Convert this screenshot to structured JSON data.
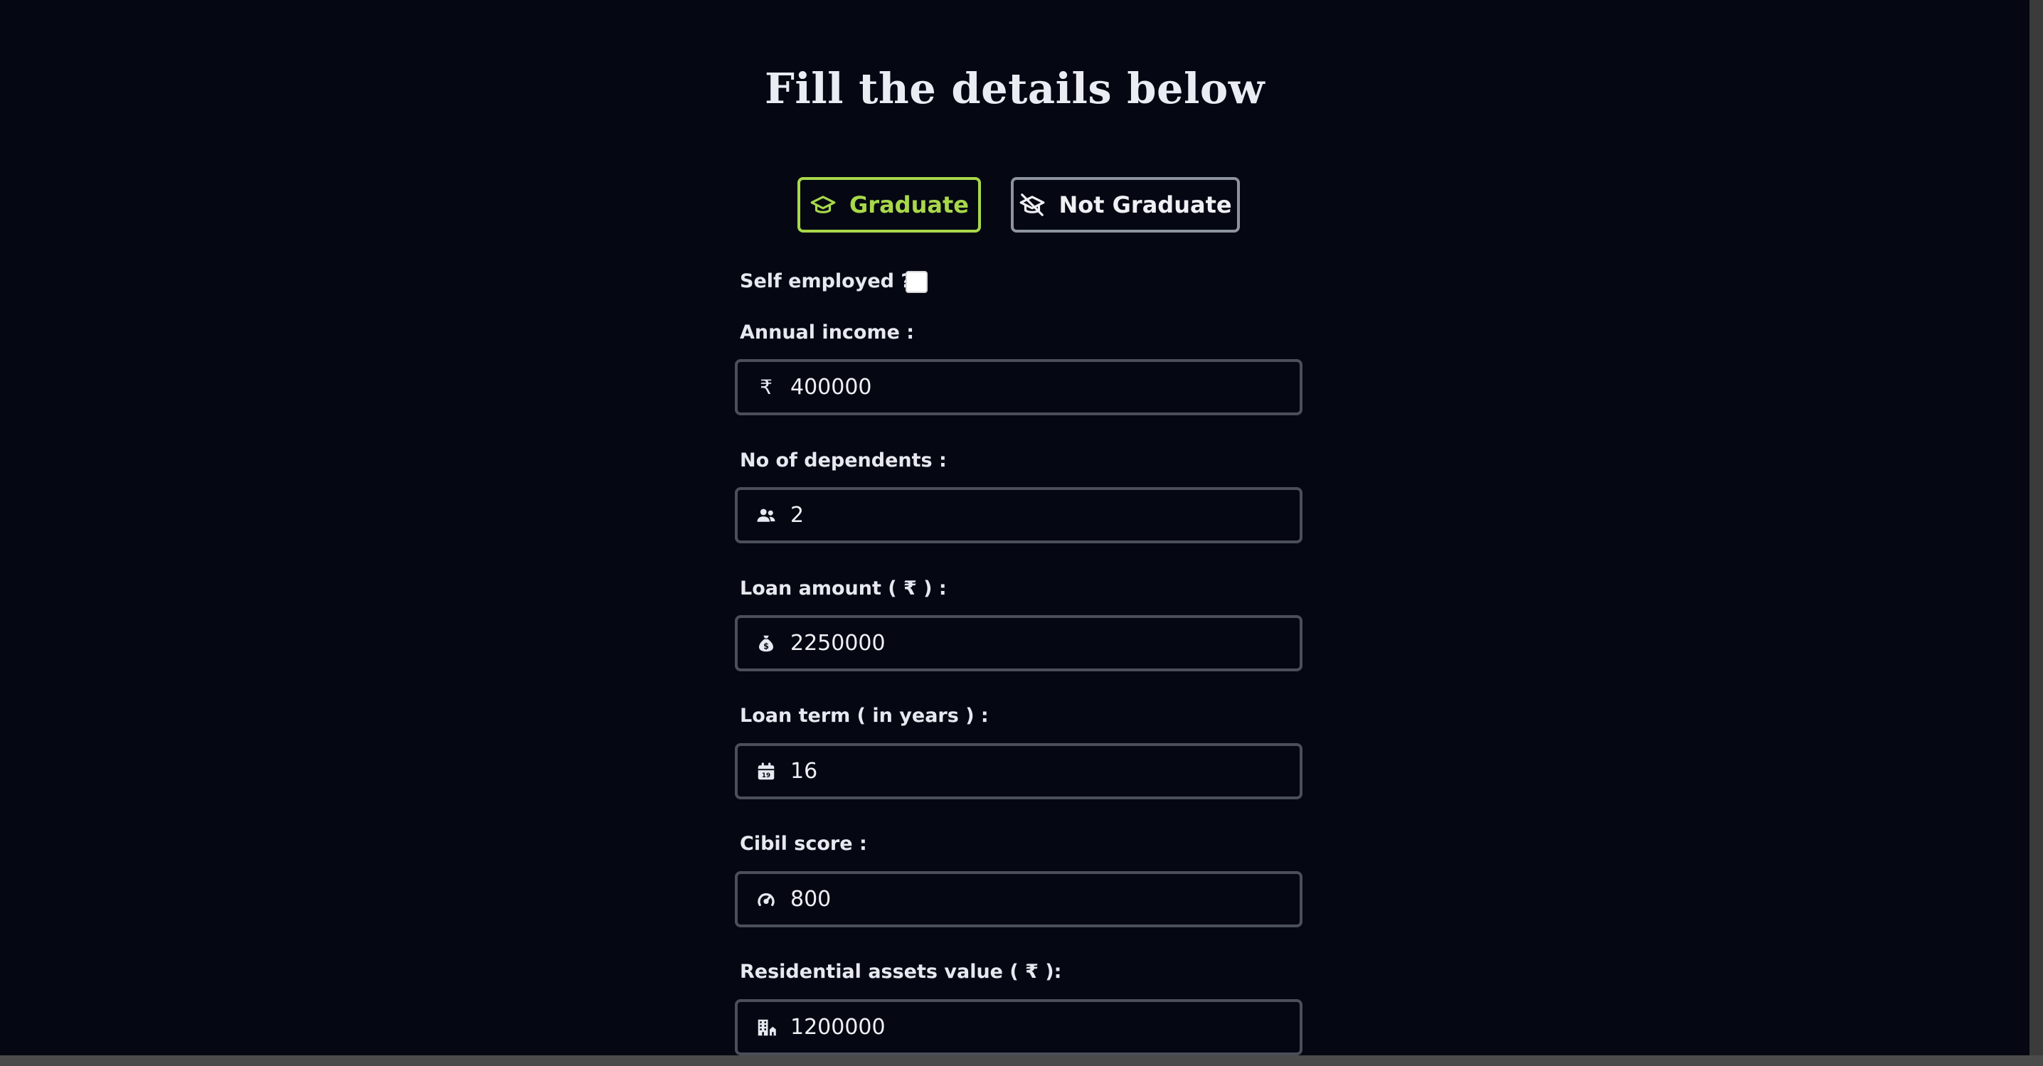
{
  "form": {
    "title": "Fill the details below",
    "education": {
      "graduate_label": "Graduate",
      "not_graduate_label": "Not Graduate",
      "selected": "Graduate",
      "selected_color": "#a8d84a"
    },
    "self_employed": {
      "label": "Self employed ?",
      "checked": false
    },
    "annual_income": {
      "label": "Annual income :",
      "icon": "rupee-icon",
      "value": "400000"
    },
    "dependents": {
      "label": "No of dependents :",
      "icon": "users-icon",
      "value": "2"
    },
    "loan_amount": {
      "label": "Loan amount ( ₹ ) :",
      "icon": "money-bag-icon",
      "value": "2250000"
    },
    "loan_term": {
      "label": "Loan term ( in years ) :",
      "icon": "calendar-icon",
      "value": "16"
    },
    "cibil_score": {
      "label": "Cibil score :",
      "icon": "gauge-icon",
      "value": "800"
    },
    "residential_assets": {
      "label": "Residential assets value ( ₹ ):",
      "icon": "building-icon",
      "value": "1200000"
    }
  }
}
